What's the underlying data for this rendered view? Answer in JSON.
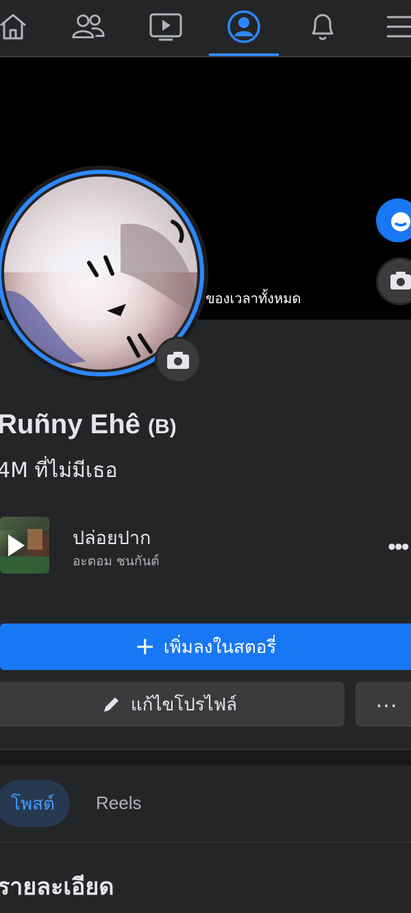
{
  "nav": {
    "items": [
      {
        "name": "home",
        "icon": "home-icon"
      },
      {
        "name": "friends",
        "icon": "friends-icon"
      },
      {
        "name": "watch",
        "icon": "video-icon"
      },
      {
        "name": "profile",
        "icon": "profile-icon",
        "active": true
      },
      {
        "name": "notifications",
        "icon": "bell-icon"
      },
      {
        "name": "menu",
        "icon": "hamburger-icon"
      }
    ],
    "accent_color": "#2d88ff"
  },
  "cover": {
    "caption": "ของเวลาทั้งหมด"
  },
  "profile": {
    "name": "Ruñny Ehê",
    "name_suffix": "(B)",
    "bio": "4M ที่ไม่มีเธอ"
  },
  "music": {
    "song": "ปล่อยปาก",
    "artist": "อะตอม ชนกันต์"
  },
  "actions": {
    "add_story": "เพิ่มลงในสตอรี่",
    "edit_profile": "แก้ไขโปรไฟล์",
    "more": "···"
  },
  "tabs": {
    "posts": "โพสต์",
    "reels": "Reels"
  },
  "details": {
    "title": "รายละเอียด"
  }
}
